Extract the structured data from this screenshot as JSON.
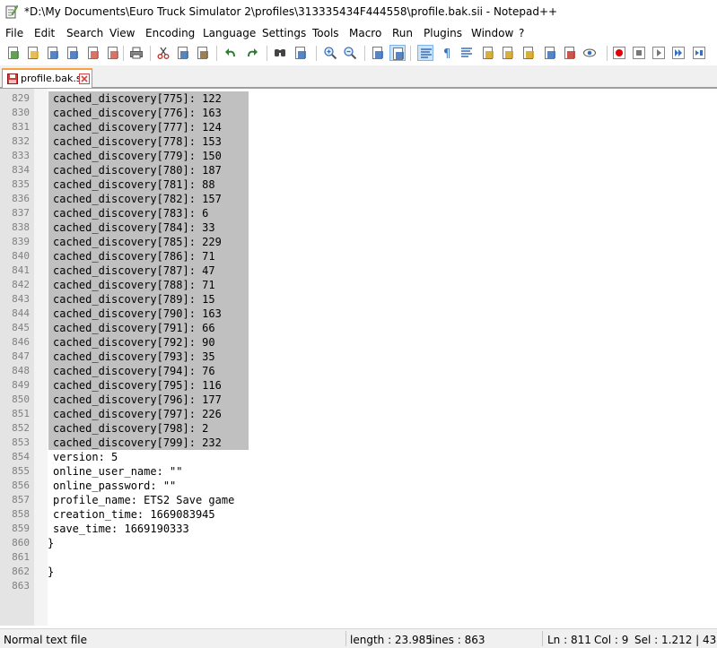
{
  "window": {
    "title": "*D:\\My Documents\\Euro Truck Simulator 2\\profiles\\313335434F444558\\profile.bak.sii - Notepad++"
  },
  "menu": [
    "File",
    "Edit",
    "Search",
    "View",
    "Encoding",
    "Language",
    "Settings",
    "Tools",
    "Macro",
    "Run",
    "Plugins",
    "Window",
    "?"
  ],
  "toolbar": {
    "buttons": [
      "new-file",
      "open-file",
      "save",
      "save-all",
      "close",
      "close-all",
      "print",
      "cut",
      "copy",
      "paste",
      "undo",
      "redo",
      "find",
      "replace",
      "zoom-in",
      "zoom-out",
      "sync-vertical",
      "sync-horizontal",
      "word-wrap",
      "show-all-chars",
      "indent-guide",
      "function-list",
      "folder-as-workspace",
      "document-map",
      "doc-list",
      "project-panel",
      "monitoring",
      "record-macro",
      "stop-record",
      "play-macro",
      "run-macro-multiple",
      "save-macro"
    ]
  },
  "tab": {
    "label": "profile.bak.sii"
  },
  "editor": {
    "selection_color": "#c0c0c0",
    "lines": [
      {
        "n": "829",
        "text": "cached_discovery[775]: 122",
        "sel": true
      },
      {
        "n": "830",
        "text": "cached_discovery[776]: 163",
        "sel": true
      },
      {
        "n": "831",
        "text": "cached_discovery[777]: 124",
        "sel": true
      },
      {
        "n": "832",
        "text": "cached_discovery[778]: 153",
        "sel": true
      },
      {
        "n": "833",
        "text": "cached_discovery[779]: 150",
        "sel": true
      },
      {
        "n": "834",
        "text": "cached_discovery[780]: 187",
        "sel": true
      },
      {
        "n": "835",
        "text": "cached_discovery[781]: 88",
        "sel": true
      },
      {
        "n": "836",
        "text": "cached_discovery[782]: 157",
        "sel": true
      },
      {
        "n": "837",
        "text": "cached_discovery[783]: 6",
        "sel": true
      },
      {
        "n": "838",
        "text": "cached_discovery[784]: 33",
        "sel": true
      },
      {
        "n": "839",
        "text": "cached_discovery[785]: 229",
        "sel": true
      },
      {
        "n": "840",
        "text": "cached_discovery[786]: 71",
        "sel": true
      },
      {
        "n": "841",
        "text": "cached_discovery[787]: 47",
        "sel": true
      },
      {
        "n": "842",
        "text": "cached_discovery[788]: 71",
        "sel": true
      },
      {
        "n": "843",
        "text": "cached_discovery[789]: 15",
        "sel": true
      },
      {
        "n": "844",
        "text": "cached_discovery[790]: 163",
        "sel": true
      },
      {
        "n": "845",
        "text": "cached_discovery[791]: 66",
        "sel": true
      },
      {
        "n": "846",
        "text": "cached_discovery[792]: 90",
        "sel": true
      },
      {
        "n": "847",
        "text": "cached_discovery[793]: 35",
        "sel": true
      },
      {
        "n": "848",
        "text": "cached_discovery[794]: 76",
        "sel": true
      },
      {
        "n": "849",
        "text": "cached_discovery[795]: 116",
        "sel": true
      },
      {
        "n": "850",
        "text": "cached_discovery[796]: 177",
        "sel": true
      },
      {
        "n": "851",
        "text": "cached_discovery[797]: 226",
        "sel": true
      },
      {
        "n": "852",
        "text": "cached_discovery[798]: 2",
        "sel": true
      },
      {
        "n": "853",
        "text": "cached_discovery[799]: 232",
        "sel": true
      },
      {
        "n": "854",
        "text": "version: 5",
        "sel": false
      },
      {
        "n": "855",
        "text": "online_user_name: \"\"",
        "sel": false
      },
      {
        "n": "856",
        "text": "online_password: \"\"",
        "sel": false
      },
      {
        "n": "857",
        "text": "profile_name: ETS2 Save game",
        "sel": false
      },
      {
        "n": "858",
        "text": "creation_time: 1669083945",
        "sel": false
      },
      {
        "n": "859",
        "text": "save_time: 1669190333",
        "sel": false
      },
      {
        "n": "860",
        "text": "}",
        "sel": false,
        "outdent": true
      },
      {
        "n": "861",
        "text": "",
        "sel": false
      },
      {
        "n": "862",
        "text": "}",
        "sel": false,
        "outdent": true
      },
      {
        "n": "863",
        "text": "",
        "sel": false
      }
    ]
  },
  "status": {
    "file_type": "Normal text file",
    "length": "length : 23.985",
    "lines": "lines : 863",
    "ln": "Ln : 811",
    "col": "Col : 9",
    "sel": "Sel : 1.212 | 43"
  }
}
